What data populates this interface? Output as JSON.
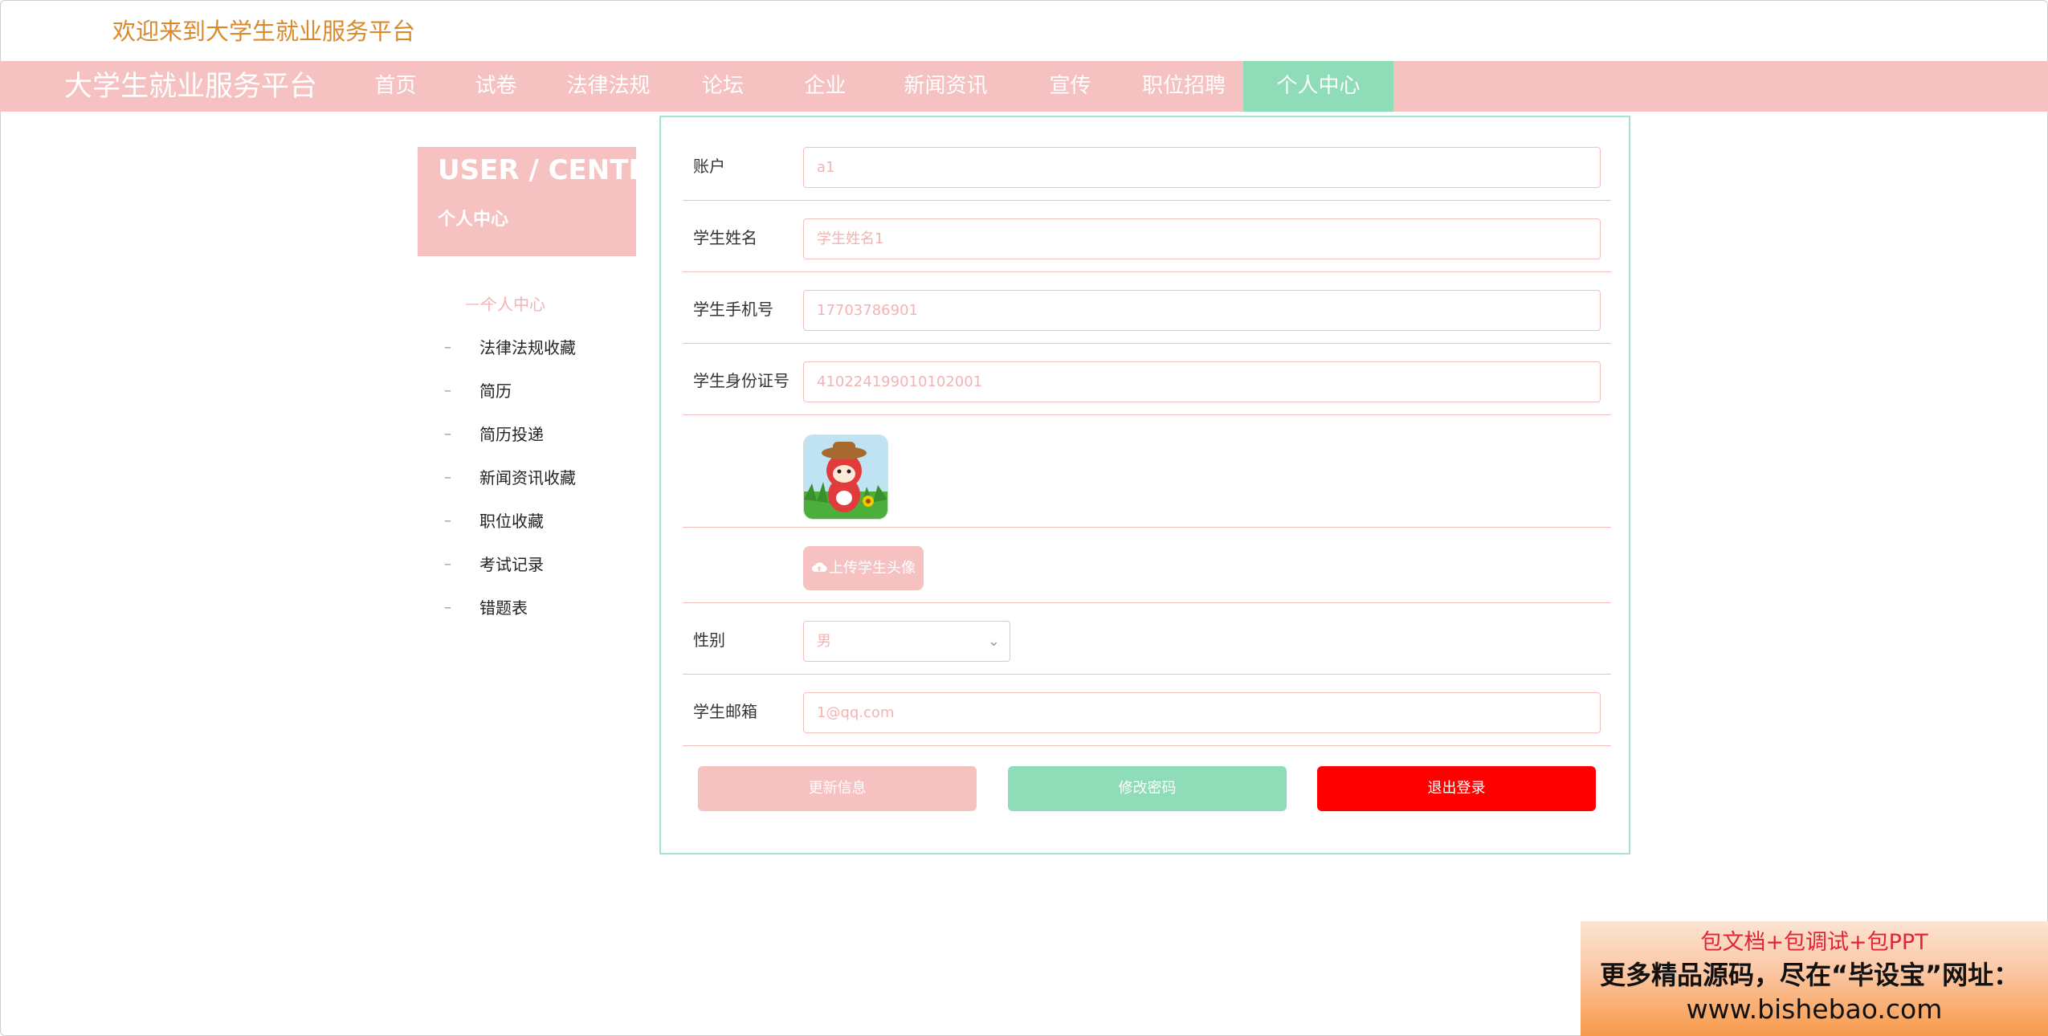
{
  "header": {
    "welcome": "欢迎来到大学生就业服务平台"
  },
  "nav": {
    "brand": "大学生就业服务平台",
    "items": [
      {
        "label": "首页"
      },
      {
        "label": "试卷"
      },
      {
        "label": "法律法规"
      },
      {
        "label": "论坛"
      },
      {
        "label": "企业"
      },
      {
        "label": "新闻资讯"
      },
      {
        "label": "宣传"
      },
      {
        "label": "职位招聘"
      },
      {
        "label": "个人中心"
      }
    ],
    "active": "个人中心"
  },
  "sidebar": {
    "title": "USER / CENTER",
    "subtitle": "个人中心",
    "active_item": "个人中心",
    "items": [
      {
        "label": "法律法规收藏"
      },
      {
        "label": "简历"
      },
      {
        "label": "简历投递"
      },
      {
        "label": "新闻资讯收藏"
      },
      {
        "label": "职位收藏"
      },
      {
        "label": "考试记录"
      },
      {
        "label": "错题表"
      }
    ]
  },
  "form": {
    "account": {
      "label": "账户",
      "value": "a1"
    },
    "name": {
      "label": "学生姓名",
      "value": "学生姓名1"
    },
    "phone": {
      "label": "学生手机号",
      "value": "17703786901"
    },
    "id_card": {
      "label": "学生身份证号",
      "value": "410224199010102001"
    },
    "upload_label": "上传学生头像",
    "gender": {
      "label": "性别",
      "value": "男"
    },
    "email": {
      "label": "学生邮箱",
      "value": "1@qq.com"
    },
    "buttons": {
      "update": "更新信息",
      "change_password": "修改密码",
      "logout": "退出登录"
    }
  },
  "ad": {
    "line1": "包文档+包调试+包PPT",
    "line2": "更多精品源码，尽在“毕设宝”网址：",
    "line3": "www.bishebao.com"
  },
  "colors": {
    "primary_pink": "#f5c1c1",
    "accent_green": "#8fdcb9",
    "logout_red": "#ff0000",
    "welcome_orange": "#d98a2b"
  }
}
